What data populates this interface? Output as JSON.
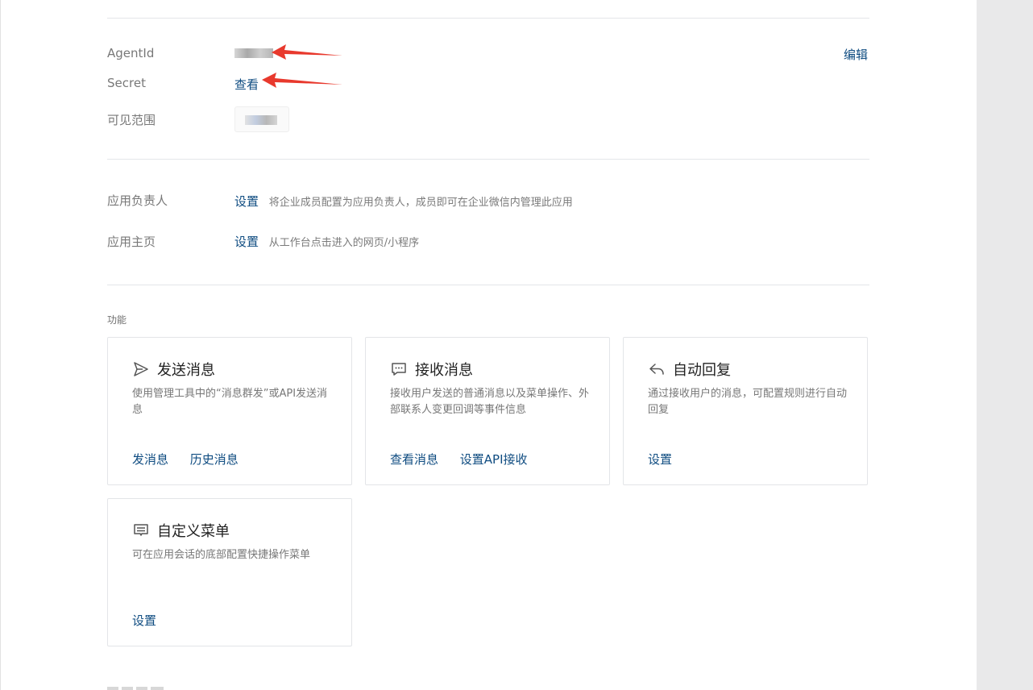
{
  "info": {
    "agentid_label": "AgentId",
    "secret_label": "Secret",
    "secret_link": "查看",
    "visible_label": "可见范围",
    "edit_link": "编辑"
  },
  "settings": {
    "owner_label": "应用负责人",
    "owner_link": "设置",
    "owner_desc": "将企业成员配置为应用负责人，成员即可在企业微信内管理此应用",
    "home_label": "应用主页",
    "home_link": "设置",
    "home_desc": "从工作台点击进入的网页/小程序"
  },
  "features": {
    "title": "功能",
    "cards": [
      {
        "icon": "send-icon",
        "title": "发送消息",
        "desc": "使用管理工具中的“消息群发”或API发送消息",
        "actions": [
          "发消息",
          "历史消息"
        ]
      },
      {
        "icon": "message-icon",
        "title": "接收消息",
        "desc": "接收用户发送的普通消息以及菜单操作、外部联系人变更回调等事件信息",
        "actions": [
          "查看消息",
          "设置API接收"
        ]
      },
      {
        "icon": "reply-icon",
        "title": "自动回复",
        "desc": "通过接收用户的消息，可配置规则进行自动回复",
        "actions": [
          "设置"
        ]
      },
      {
        "icon": "menu-icon",
        "title": "自定义菜单",
        "desc": "可在应用会话的底部配置快捷操作菜单",
        "actions": [
          "设置"
        ]
      }
    ]
  },
  "colors": {
    "link": "#0f4c81",
    "arrow": "#e8392d"
  }
}
